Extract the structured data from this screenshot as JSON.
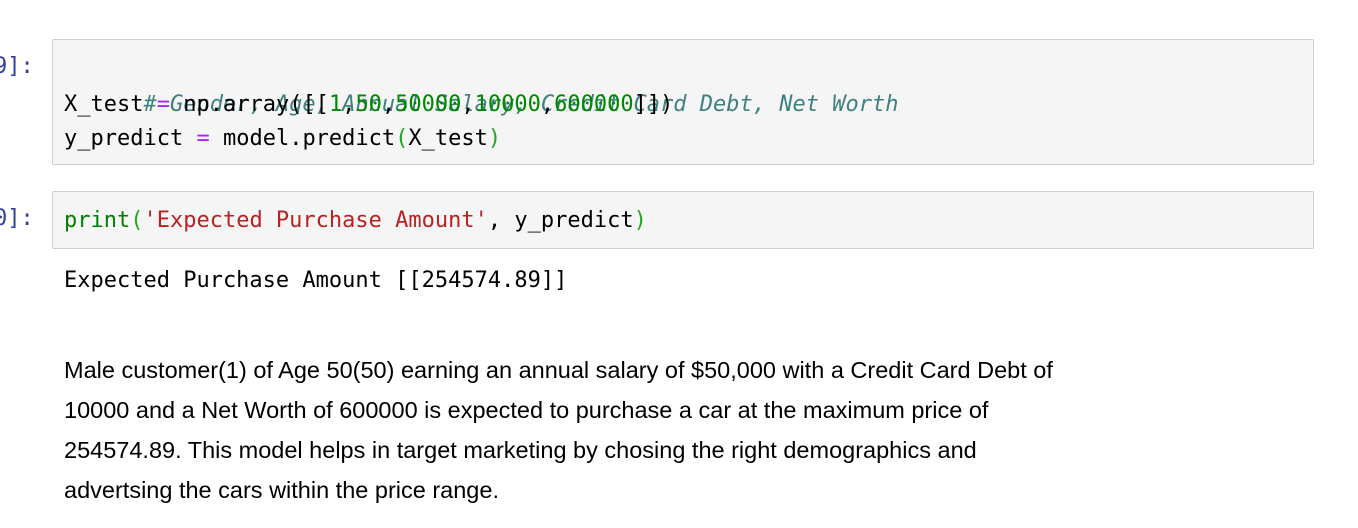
{
  "cell1": {
    "prompt": "9]:",
    "line1": "# Gender, Age, Annual Salary, Credit Card Debt, Net Worth",
    "line2": {
      "a": "X_test",
      "op": "=",
      "b": "np.array([[",
      "n1": "1",
      "c1": ",",
      "n2": "50",
      "c2": ",",
      "n3": "50000",
      "c3": ",",
      "n4": "10000",
      "c4": ",",
      "n5": "600000",
      "end": "]])"
    },
    "line3": {
      "a": "y_predict",
      "op": "=",
      "b": "model.predict",
      "p1": "(",
      "arg": "X_test",
      "p2": ")"
    }
  },
  "cell2": {
    "prompt": "0]:",
    "fn": "print",
    "p1": "(",
    "str": "'Expected Purchase Amount'",
    "comma": ",",
    "arg": "y_predict",
    "p2": ")",
    "output": "Expected Purchase Amount [[254574.89]]"
  },
  "markdown": {
    "lines": [
      "Male customer(1) of Age 50(50) earning an annual salary of $50,000 with a Credit Card Debt of",
      "10000 and a Net Worth of 600000 is expected to purchase a car at the maximum price of",
      "254574.89. This model helps in target marketing by chosing the right demographics and",
      "advertsing the cars within the price range."
    ]
  }
}
